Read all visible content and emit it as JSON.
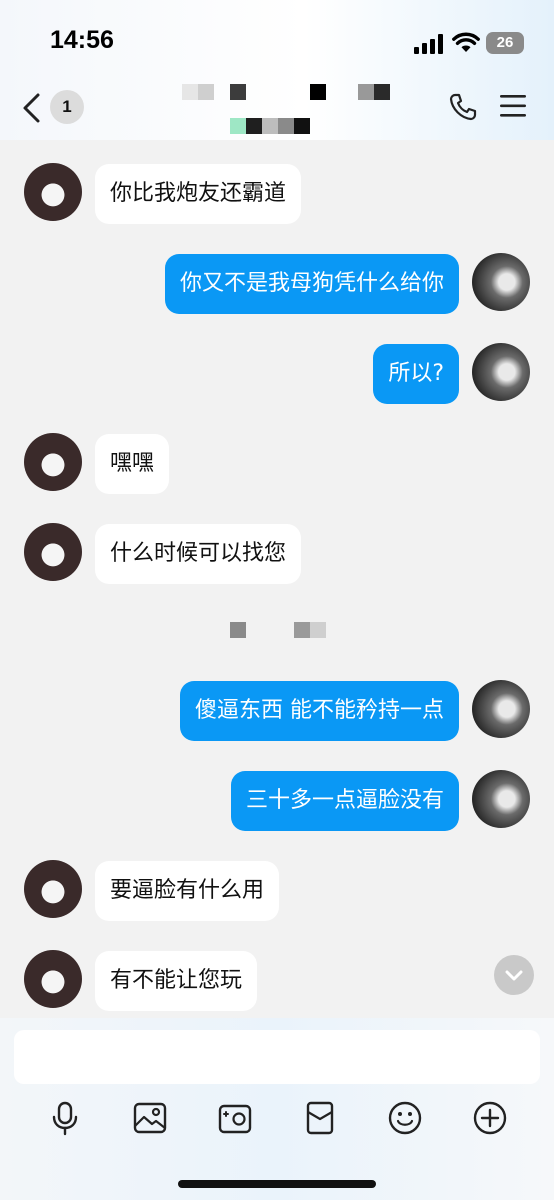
{
  "status_bar": {
    "time": "14:56",
    "battery": "26"
  },
  "header": {
    "unread_count": "1"
  },
  "messages": [
    {
      "side": "in",
      "text": "你比我炮友还霸道"
    },
    {
      "side": "out",
      "text": "你又不是我母狗凭什么给你"
    },
    {
      "side": "out",
      "text": "所以?"
    },
    {
      "side": "in",
      "text": "嘿嘿"
    },
    {
      "side": "in",
      "text": "什么时候可以找您"
    },
    {
      "side": "out",
      "text": "傻逼东西 能不能矜持一点"
    },
    {
      "side": "out",
      "text": "三十多一点逼脸没有"
    },
    {
      "side": "in",
      "text": "要逼脸有什么用"
    },
    {
      "side": "in",
      "text": "有不能让您玩"
    }
  ],
  "input": {
    "value": ""
  },
  "toolbar": {
    "icons": [
      "microphone-icon",
      "image-icon",
      "camera-icon",
      "red-packet-icon",
      "emoji-icon",
      "plus-icon"
    ]
  },
  "colors": {
    "outgoing_bubble": "#0a98f5",
    "incoming_bubble": "#ffffff",
    "background": "#f2f2f2"
  }
}
